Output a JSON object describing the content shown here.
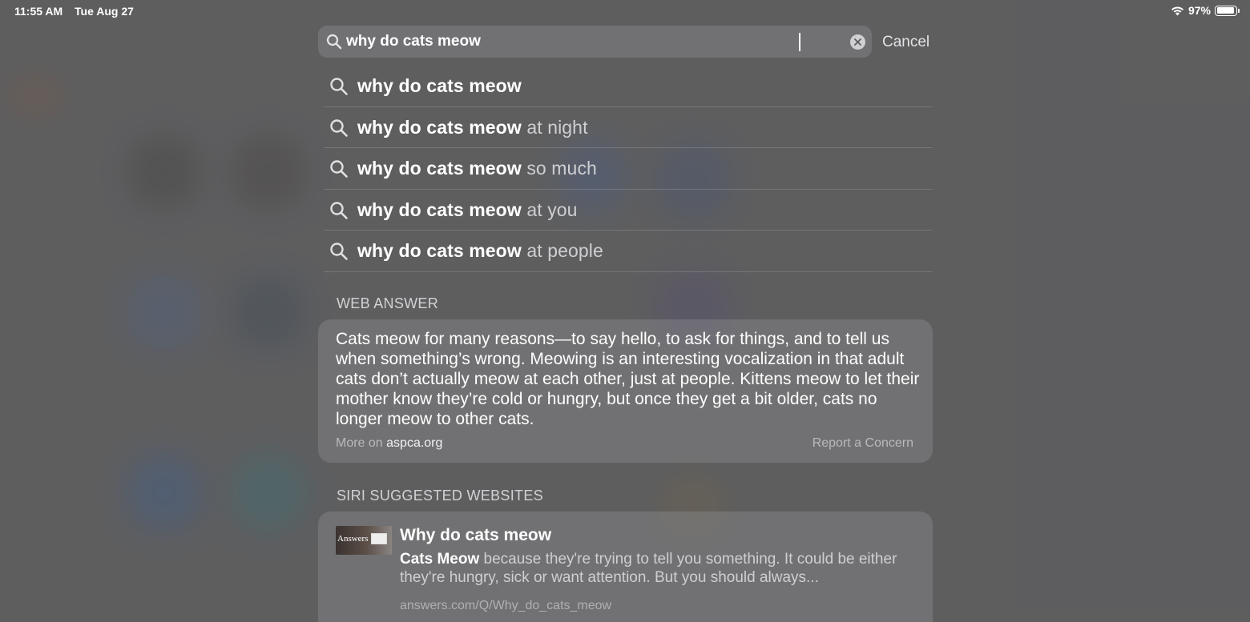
{
  "status_bar": {
    "time": "11:55 AM",
    "date": "Tue Aug 27",
    "battery": "97%",
    "wifi_icon": "wifi-icon",
    "battery_icon": "battery-icon"
  },
  "search": {
    "query": "why do cats meow",
    "placeholder": "",
    "cancel_label": "Cancel",
    "icon": "search-icon",
    "clear_icon": "clear-icon"
  },
  "suggestions": [
    {
      "prefix": "why do cats meow",
      "suffix": ""
    },
    {
      "prefix": "why do cats meow",
      "suffix": " at night"
    },
    {
      "prefix": "why do cats meow",
      "suffix": " so much"
    },
    {
      "prefix": "why do cats meow",
      "suffix": " at you"
    },
    {
      "prefix": "why do cats meow",
      "suffix": " at people"
    }
  ],
  "web_answer": {
    "heading": "WEB ANSWER",
    "text": "Cats meow for many reasons—to say hello, to ask for things, and to tell us when something’s wrong. Meowing is an interesting vocalization in that adult cats don’t actually meow at each other, just at people. Kittens meow to let their mother know they’re cold or hungry, but once they get a bit older, cats no longer meow to other cats.",
    "more_prefix": "More on ",
    "source_domain": "aspca.org",
    "report_label": "Report a Concern"
  },
  "suggested_websites": {
    "heading": "SIRI SUGGESTED WEBSITES",
    "items": [
      {
        "thumbnail_label": "Answers",
        "title": "Why do cats meow",
        "desc_bold": "Cats Meow",
        "desc_rest": " because they're trying to tell you something. It could be either they're hungry, sick or want attention. But you should always...",
        "url": "answers.com/Q/Why_do_cats_meow"
      }
    ]
  }
}
